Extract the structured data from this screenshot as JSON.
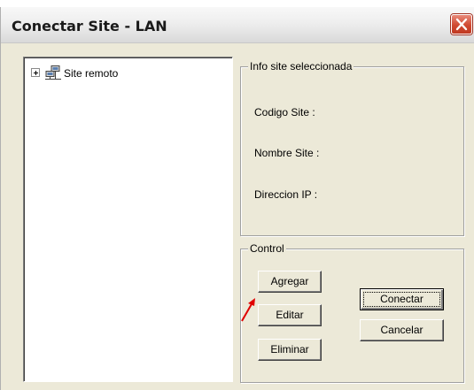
{
  "window": {
    "title": "Conectar Site - LAN",
    "close_icon": "close-icon",
    "close_color": "#d04a32"
  },
  "tree": {
    "items": [
      {
        "label": "Site remoto",
        "icon": "network-icon",
        "expanded": false
      }
    ]
  },
  "info_group": {
    "legend": "Info site seleccionada",
    "fields": [
      {
        "label": "Codigo Site :"
      },
      {
        "label": "Nombre Site :"
      },
      {
        "label": "Direccion IP :"
      }
    ]
  },
  "control_group": {
    "legend": "Control",
    "buttons": {
      "agregar": "Agregar",
      "editar": "Editar",
      "eliminar": "Eliminar",
      "conectar": "Conectar",
      "cancelar": "Cancelar"
    }
  },
  "annotation": {
    "icon": "red-arrow-icon",
    "color": "#e00000"
  }
}
